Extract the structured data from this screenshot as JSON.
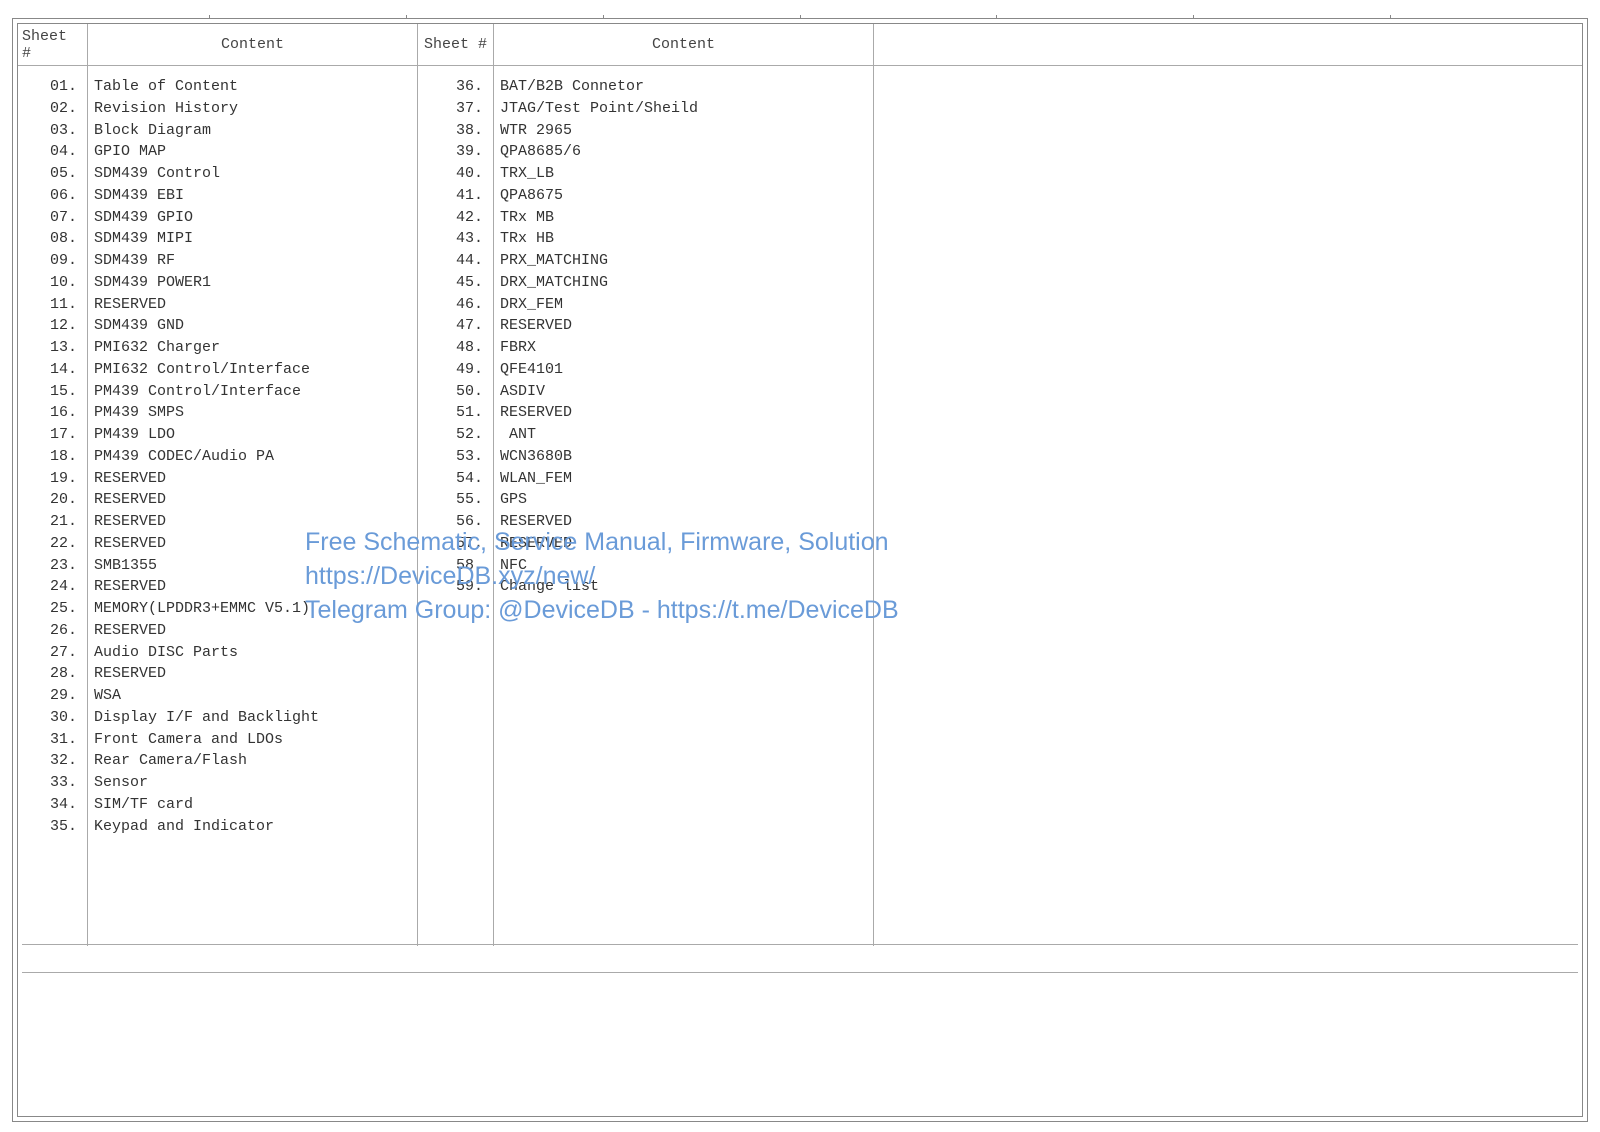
{
  "headers": {
    "sheet_a": "Sheet #",
    "content_a": "Content",
    "sheet_b": "Sheet #",
    "content_b": "Content"
  },
  "table_of_contents": {
    "col1": [
      {
        "num": "01.",
        "title": "Table of Content"
      },
      {
        "num": "02.",
        "title": "Revision History"
      },
      {
        "num": "03.",
        "title": "Block Diagram"
      },
      {
        "num": "04.",
        "title": "GPIO MAP"
      },
      {
        "num": "05.",
        "title": "SDM439 Control"
      },
      {
        "num": "06.",
        "title": "SDM439 EBI"
      },
      {
        "num": "07.",
        "title": "SDM439 GPIO"
      },
      {
        "num": "08.",
        "title": "SDM439 MIPI"
      },
      {
        "num": "09.",
        "title": "SDM439 RF"
      },
      {
        "num": "10.",
        "title": "SDM439 POWER1"
      },
      {
        "num": "11.",
        "title": "RESERVED"
      },
      {
        "num": "12.",
        "title": "SDM439 GND"
      },
      {
        "num": "13.",
        "title": "PMI632 Charger"
      },
      {
        "num": "14.",
        "title": "PMI632 Control/Interface"
      },
      {
        "num": "15.",
        "title": "PM439 Control/Interface"
      },
      {
        "num": "16.",
        "title": "PM439 SMPS"
      },
      {
        "num": "17.",
        "title": "PM439 LDO"
      },
      {
        "num": "18.",
        "title": "PM439 CODEC/Audio PA"
      },
      {
        "num": "19.",
        "title": "RESERVED"
      },
      {
        "num": "20.",
        "title": "RESERVED"
      },
      {
        "num": "21.",
        "title": "RESERVED"
      },
      {
        "num": "22.",
        "title": "RESERVED"
      },
      {
        "num": "23.",
        "title": "SMB1355"
      },
      {
        "num": "24.",
        "title": "RESERVED"
      },
      {
        "num": "25.",
        "title": "MEMORY(LPDDR3+EMMC V5.1)"
      },
      {
        "num": "26.",
        "title": "RESERVED"
      },
      {
        "num": "27.",
        "title": "Audio DISC Parts"
      },
      {
        "num": "28.",
        "title": "RESERVED"
      },
      {
        "num": "29.",
        "title": "WSA"
      },
      {
        "num": "30.",
        "title": "Display I/F and Backlight"
      },
      {
        "num": "31.",
        "title": "Front Camera and LDOs"
      },
      {
        "num": "32.",
        "title": "Rear Camera/Flash"
      },
      {
        "num": "33.",
        "title": "Sensor"
      },
      {
        "num": "34.",
        "title": "SIM/TF card"
      },
      {
        "num": "35.",
        "title": "Keypad and Indicator"
      }
    ],
    "col2": [
      {
        "num": "36.",
        "title": "BAT/B2B Connetor"
      },
      {
        "num": "37.",
        "title": "JTAG/Test Point/Sheild"
      },
      {
        "num": "38.",
        "title": "WTR 2965"
      },
      {
        "num": "39.",
        "title": "QPA8685/6"
      },
      {
        "num": "40.",
        "title": "TRX_LB"
      },
      {
        "num": "41.",
        "title": "QPA8675"
      },
      {
        "num": "42.",
        "title": "TRx MB"
      },
      {
        "num": "43.",
        "title": "TRx HB"
      },
      {
        "num": "44.",
        "title": "PRX_MATCHING"
      },
      {
        "num": "45.",
        "title": "DRX_MATCHING"
      },
      {
        "num": "46.",
        "title": "DRX_FEM"
      },
      {
        "num": "47.",
        "title": "RESERVED"
      },
      {
        "num": "48.",
        "title": "FBRX"
      },
      {
        "num": "49.",
        "title": "QFE4101"
      },
      {
        "num": "50.",
        "title": "ASDIV"
      },
      {
        "num": "51.",
        "title": "RESERVED"
      },
      {
        "num": "52.",
        "title": " ANT"
      },
      {
        "num": "53.",
        "title": "WCN3680B"
      },
      {
        "num": "54.",
        "title": "WLAN_FEM"
      },
      {
        "num": "55.",
        "title": "GPS"
      },
      {
        "num": "56.",
        "title": "RESERVED"
      },
      {
        "num": "57.",
        "title": "RESERVED"
      },
      {
        "num": "58.",
        "title": "NFC"
      },
      {
        "num": "59.",
        "title": "Change list"
      }
    ]
  },
  "watermark": {
    "line1": "Free Schematic, Service Manual, Firmware, Solution",
    "line2": "https://DeviceDB.xyz/new/",
    "line3": "Telegram Group: @DeviceDB - https://t.me/DeviceDB"
  }
}
